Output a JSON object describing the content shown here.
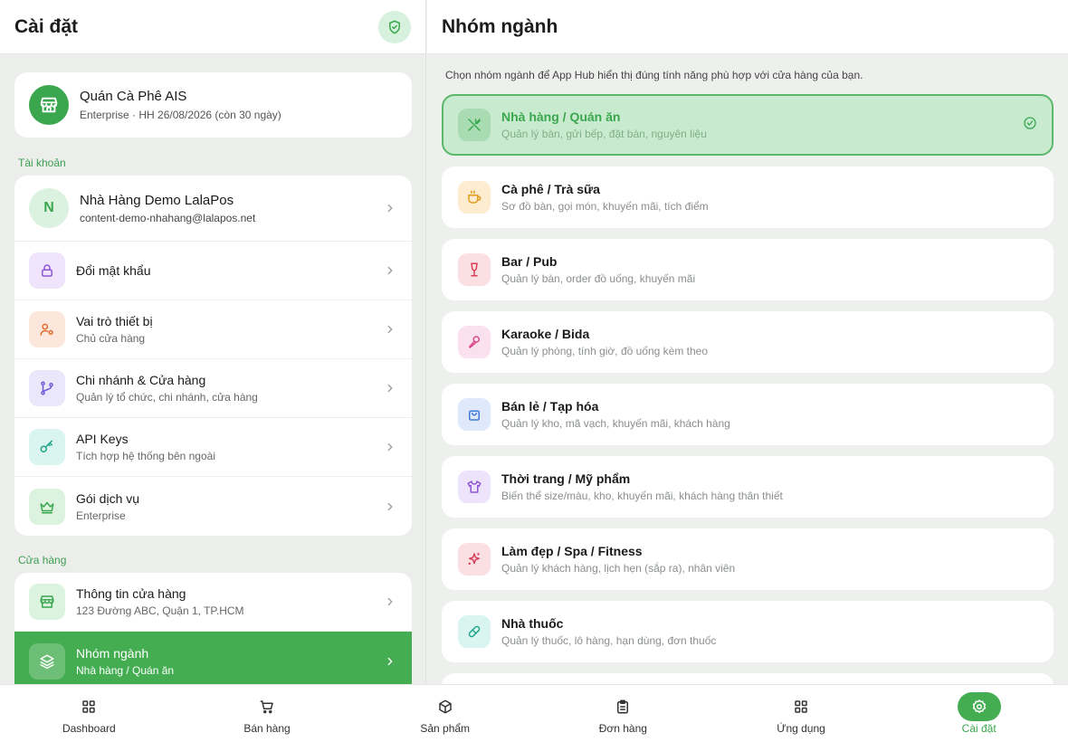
{
  "left": {
    "title": "Cài đặt",
    "store": {
      "name": "Quán Cà Phê AIS",
      "subtitle": "Enterprise · HH 26/08/2026 (còn 30 ngày)"
    },
    "account_section": "Tài khoản",
    "account": {
      "initial": "N",
      "name": "Nhà Hàng Demo LalaPos",
      "email": "content-demo-nhahang@lalapos.net"
    },
    "account_items": [
      {
        "label": "Đổi mật khẩu",
        "sub": ""
      },
      {
        "label": "Vai trò thiết bị",
        "sub": "Chủ cửa hàng"
      },
      {
        "label": "Chi nhánh & Cửa hàng",
        "sub": "Quản lý tổ chức, chi nhánh, cửa hàng"
      },
      {
        "label": "API Keys",
        "sub": "Tích hợp hệ thống bên ngoài"
      },
      {
        "label": "Gói dịch vụ",
        "sub": "Enterprise"
      }
    ],
    "store_section": "Cửa hàng",
    "store_items": [
      {
        "label": "Thông tin cửa hàng",
        "sub": "123 Đường ABC, Quận 1, TP.HCM"
      },
      {
        "label": "Nhóm ngành",
        "sub": "Nhà hàng / Quán ăn"
      }
    ]
  },
  "right": {
    "title": "Nhóm ngành",
    "description": "Chọn nhóm ngành để App Hub hiển thị đúng tính năng phù hợp với cửa hàng của bạn.",
    "categories": [
      {
        "label": "Nhà hàng / Quán ăn",
        "sub": "Quản lý bàn, gửi bếp, đặt bàn, nguyên liệu",
        "icon": "utensils-icon",
        "selected": true
      },
      {
        "label": "Cà phê / Trà sữa",
        "sub": "Sơ đồ bàn, gọi món, khuyến mãi, tích điểm",
        "icon": "coffee-icon"
      },
      {
        "label": "Bar / Pub",
        "sub": "Quản lý bàn, order đồ uống, khuyến mãi",
        "icon": "wine-icon"
      },
      {
        "label": "Karaoke / Bida",
        "sub": "Quản lý phòng, tính giờ, đồ uống kèm theo",
        "icon": "microphone-icon"
      },
      {
        "label": "Bán lẻ / Tạp hóa",
        "sub": "Quản lý kho, mã vạch, khuyến mãi, khách hàng",
        "icon": "shopping-bag-icon"
      },
      {
        "label": "Thời trang / Mỹ phẩm",
        "sub": "Biến thể size/màu, kho, khuyến mãi, khách hàng thân thiết",
        "icon": "shirt-icon"
      },
      {
        "label": "Làm đẹp / Spa / Fitness",
        "sub": "Quản lý khách hàng, lịch hẹn (sắp ra), nhân viên",
        "icon": "sparkles-icon"
      },
      {
        "label": "Nhà thuốc",
        "sub": "Quản lý thuốc, lô hàng, hạn dùng, đơn thuốc",
        "icon": "pill-icon"
      }
    ]
  },
  "nav": [
    {
      "label": "Dashboard",
      "icon": "grid-icon"
    },
    {
      "label": "Bán hàng",
      "icon": "cart-icon"
    },
    {
      "label": "Sản phẩm",
      "icon": "box-icon"
    },
    {
      "label": "Đơn hàng",
      "icon": "clipboard-icon"
    },
    {
      "label": "Ứng dụng",
      "icon": "apps-icon"
    },
    {
      "label": "Cài đặt",
      "icon": "settings-icon",
      "active": true
    }
  ],
  "colors": {
    "accent": "#44ad52",
    "selected_bg": "#c8ebcf"
  }
}
